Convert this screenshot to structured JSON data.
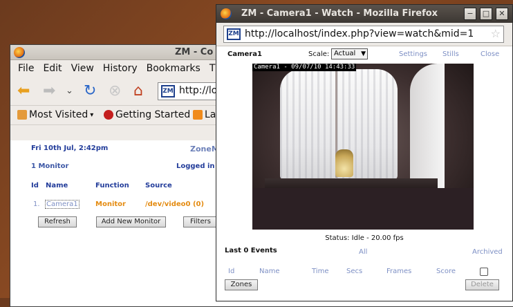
{
  "background_window": {
    "title": "ZM - Co",
    "menu": [
      "File",
      "Edit",
      "View",
      "History",
      "Bookmarks",
      "T"
    ],
    "url": "http://loc",
    "bookmarks": [
      "Most Visited",
      "Getting Started",
      "La"
    ],
    "zm": {
      "date": "Fri 10th Jul, 2:42pm",
      "title": "ZoneM",
      "monitor_count": "1 Monitor",
      "logged_in": "Logged in a",
      "columns": [
        "Id",
        "Name",
        "Function",
        "Source"
      ],
      "row": {
        "id": "1.",
        "name": "Camera1",
        "function": "Monitor",
        "source": "/dev/video0 (0)"
      },
      "buttons": {
        "refresh": "Refresh",
        "add": "Add New Monitor",
        "filters": "Filters"
      }
    }
  },
  "popup": {
    "title": "ZM - Camera1 - Watch - Mozilla Firefox",
    "url": "http://localhost/index.php?view=watch&mid=1",
    "camera": "Camera1",
    "scale_label": "Scale:",
    "scale_value": "Actual",
    "links": {
      "settings": "Settings",
      "stills": "Stills",
      "close": "Close"
    },
    "timestamp": "Camera1 - 09/07/10 14:43:33",
    "status": "Status: Idle - 20.00 fps",
    "events": {
      "title": "Last 0 Events",
      "all": "All",
      "archived": "Archived",
      "columns": [
        "Id",
        "Name",
        "Time",
        "Secs",
        "Frames",
        "Score"
      ],
      "zones_button": "Zones",
      "delete_button": "Delete"
    }
  },
  "colors": {
    "link_blue": "#7d8fc4",
    "heading_blue": "#223c9a",
    "function_orange": "#e48b11"
  }
}
